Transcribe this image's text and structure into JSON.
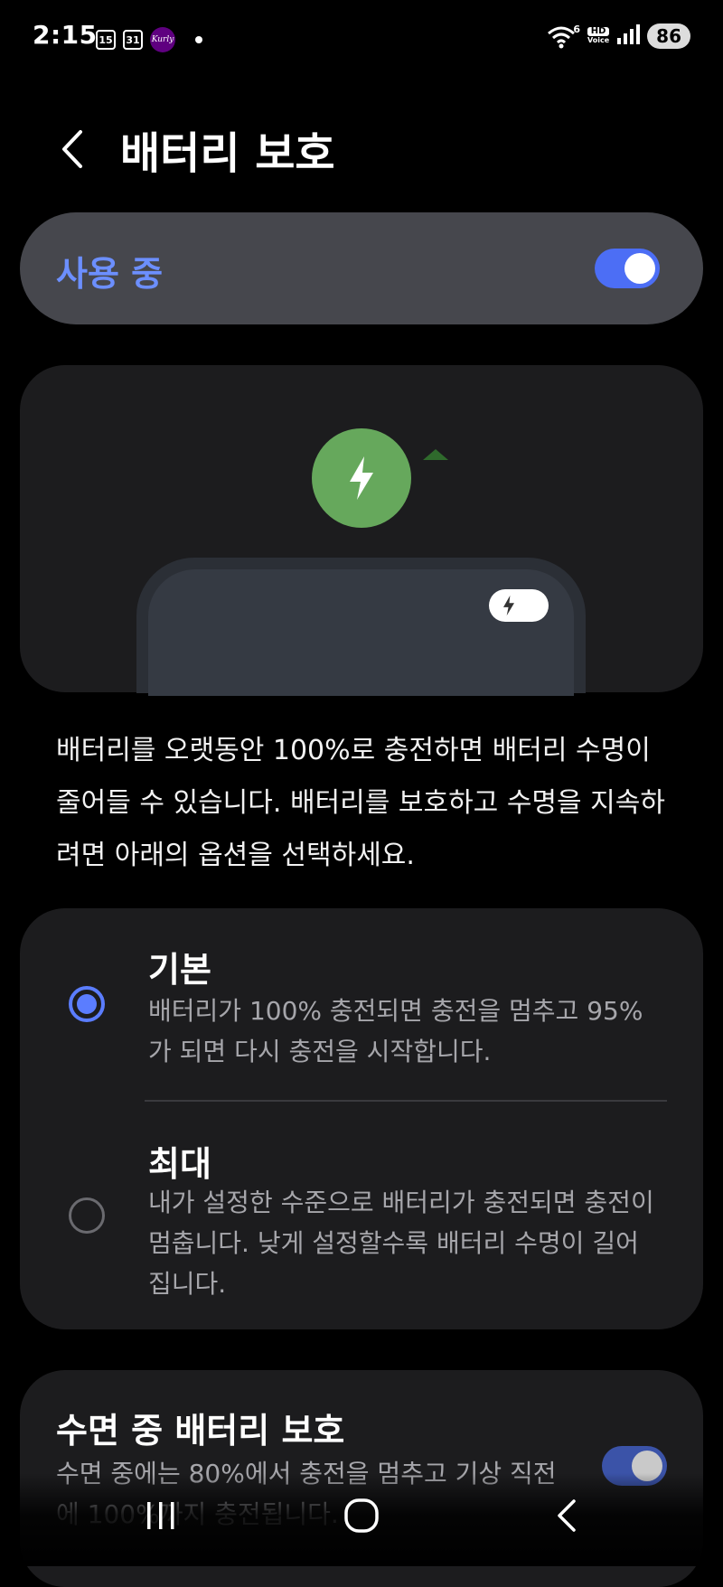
{
  "status_bar": {
    "time": "2:15",
    "calendar_1": "15",
    "calendar_2": "31",
    "app_badge": "Kurly",
    "wifi_label": "6",
    "hd_voice_top": "HD",
    "hd_voice_bottom": "Voice",
    "battery_level": "86"
  },
  "header": {
    "title": "배터리 보호",
    "back_icon": "chevron-left-icon"
  },
  "master_toggle": {
    "label": "사용 중",
    "enabled": true,
    "accent_color": "#6c8fff"
  },
  "illustration": {
    "charge_icon": "lightning-bolt-icon",
    "charge_color": "#66a85c"
  },
  "description": "배터리를 오랫동안 100%로 충전하면 배터리 수명이 줄어들 수 있습니다. 배터리를 보호하고 수명을 지속하려면 아래의 옵션을 선택하세요.",
  "options": [
    {
      "title": "기본",
      "description": "배터리가 100% 충전되면 충전을 멈추고 95%가 되면 다시 충전을 시작합니다.",
      "selected": true
    },
    {
      "title": "최대",
      "description": "내가 설정한 수준으로 배터리가 충전되면 충전이 멈춥니다. 낮게 설정할수록 배터리 수명이 길어집니다.",
      "selected": false
    }
  ],
  "sleep_protection": {
    "title": "수면 중 배터리 보호",
    "description": "수면 중에는 80%에서 충전을 멈추고 기상 직전에 100%까지 충전됩니다.",
    "enabled": true
  },
  "nav_bar": {
    "recents_icon": "recents-icon",
    "home_icon": "home-icon",
    "back_icon": "back-icon"
  }
}
